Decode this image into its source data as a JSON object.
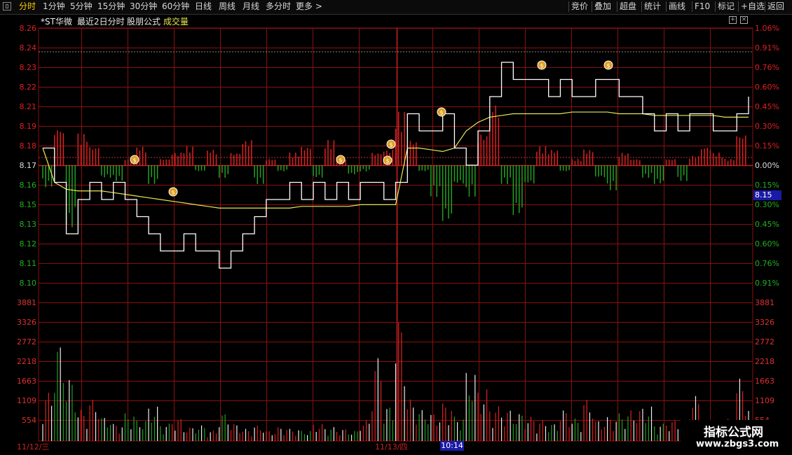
{
  "toolbar": {
    "left": [
      {
        "label": "分时",
        "active": true
      },
      {
        "label": "1分钟"
      },
      {
        "label": "5分钟"
      },
      {
        "label": "15分钟"
      },
      {
        "label": "30分钟"
      },
      {
        "label": "60分钟"
      },
      {
        "label": "日线"
      },
      {
        "label": "周线"
      },
      {
        "label": "月线"
      },
      {
        "label": "多分时"
      },
      {
        "label": "更多 >"
      }
    ],
    "right": [
      {
        "label": "竞价"
      },
      {
        "label": "叠加"
      },
      {
        "label": "超盘"
      },
      {
        "label": "统计"
      },
      {
        "label": "画线"
      },
      {
        "label": "F10"
      },
      {
        "label": "标记"
      },
      {
        "label": "+自选"
      },
      {
        "label": "返回"
      }
    ]
  },
  "header": {
    "stock": "*ST华微",
    "period": "最近2日分时",
    "formula": "股朋公式",
    "indicator": "成交量"
  },
  "colors": {
    "up": "#e02020",
    "down": "#22a022",
    "price_line": "#ffffff",
    "avg_line": "#e8e850",
    "grid": "#8a1010",
    "axis_text_up": "#e02020",
    "axis_text_down": "#22b022",
    "accent_blue": "#1a1aa8"
  },
  "price_axis": {
    "left_up": [
      "8.26",
      "8.24",
      "8.23",
      "8.22",
      "8.21",
      "8.19",
      "8.18"
    ],
    "left_mid": "8.17",
    "left_down": [
      "8.16",
      "8.15",
      "8.13",
      "8.12",
      "8.11",
      "8.10"
    ],
    "right_up": [
      "1.06%",
      "0.91%",
      "0.76%",
      "0.60%",
      "0.45%",
      "0.30%",
      "0.15%"
    ],
    "right_mid": "0.00%",
    "right_down": [
      "0.15%",
      "0.30%",
      "0.45%",
      "0.60%",
      "0.76%",
      "0.91%"
    ]
  },
  "volume_axis": [
    "3881",
    "3326",
    "2772",
    "2218",
    "1663",
    "1109",
    "554"
  ],
  "current_price": "8.15",
  "time_cursor": "10:14",
  "dates": [
    "11/12/三",
    "11/13/四"
  ],
  "watermark": {
    "line1": "指标公式网",
    "line2": "www.zbgs3.com"
  },
  "chart_data": {
    "type": "line",
    "title": "*ST华微 最近2日分时",
    "prev_close": 8.17,
    "ylim": [
      8.1,
      8.26
    ],
    "days": [
      "11/12/三",
      "11/13/四"
    ],
    "series": [
      {
        "name": "price",
        "values": [
          8.19,
          8.17,
          8.14,
          8.16,
          8.17,
          8.16,
          8.17,
          8.16,
          8.15,
          8.14,
          8.13,
          8.13,
          8.14,
          8.13,
          8.13,
          8.12,
          8.13,
          8.14,
          8.15,
          8.16,
          8.16,
          8.17,
          8.16,
          8.17,
          8.16,
          8.17,
          8.16,
          8.17,
          8.17,
          8.16,
          8.17,
          8.21,
          8.2,
          8.2,
          8.21,
          8.19,
          8.18,
          8.2,
          8.22,
          8.24,
          8.23,
          8.23,
          8.23,
          8.22,
          8.23,
          8.22,
          8.22,
          8.23,
          8.23,
          8.22,
          8.22,
          8.21,
          8.2,
          8.21,
          8.2,
          8.21,
          8.21,
          8.2,
          8.2,
          8.21,
          8.22
        ]
      },
      {
        "name": "avg",
        "values": [
          8.19,
          8.17,
          8.166,
          8.165,
          8.165,
          8.165,
          8.164,
          8.163,
          8.162,
          8.161,
          8.16,
          8.159,
          8.158,
          8.157,
          8.156,
          8.155,
          8.155,
          8.155,
          8.155,
          8.155,
          8.155,
          8.155,
          8.156,
          8.156,
          8.156,
          8.156,
          8.156,
          8.157,
          8.157,
          8.157,
          8.157,
          8.19,
          8.19,
          8.189,
          8.188,
          8.19,
          8.2,
          8.205,
          8.208,
          8.209,
          8.21,
          8.21,
          8.21,
          8.21,
          8.21,
          8.211,
          8.211,
          8.211,
          8.211,
          8.21,
          8.21,
          8.21,
          8.209,
          8.209,
          8.209,
          8.209,
          8.209,
          8.209,
          8.208,
          8.208,
          8.208
        ]
      },
      {
        "name": "volume",
        "values": [
          1400,
          2800,
          1800,
          900,
          1200,
          700,
          500,
          800,
          600,
          1000,
          500,
          650,
          400,
          450,
          300,
          800,
          500,
          350,
          450,
          300,
          400,
          350,
          300,
          500,
          400,
          350,
          300,
          600,
          2400,
          1000,
          3500,
          1200,
          900,
          800,
          1100,
          700,
          2000,
          1500,
          1000,
          900,
          800,
          700,
          600,
          500,
          900,
          650,
          1200,
          600,
          700,
          800,
          900,
          1000,
          500,
          600,
          550,
          1300,
          600,
          500,
          650,
          1800,
          1000
        ]
      },
      {
        "name": "momentum",
        "values": [
          -0.35,
          0.6,
          -1.0,
          0.5,
          0.3,
          -0.2,
          -0.25,
          0.1,
          0.3,
          -0.3,
          0.1,
          0.2,
          0.3,
          -0.1,
          0.25,
          -0.2,
          0.2,
          0.4,
          -0.3,
          0.1,
          -0.1,
          0.2,
          0.3,
          -0.2,
          0.4,
          0.1,
          -0.15,
          -0.1,
          0.2,
          0.25,
          0.85,
          0.4,
          -0.1,
          -0.5,
          -0.9,
          -0.3,
          -0.5,
          0.5,
          1.0,
          -0.3,
          -0.8,
          -0.3,
          0.3,
          0.25,
          -0.1,
          0.1,
          0.25,
          -0.2,
          -0.4,
          0.2,
          0.1,
          -0.2,
          -0.3,
          0.1,
          -0.25,
          0.15,
          0.3,
          0.2,
          0.1,
          0.5
        ]
      }
    ],
    "volume_ylim": [
      0,
      4000
    ]
  }
}
